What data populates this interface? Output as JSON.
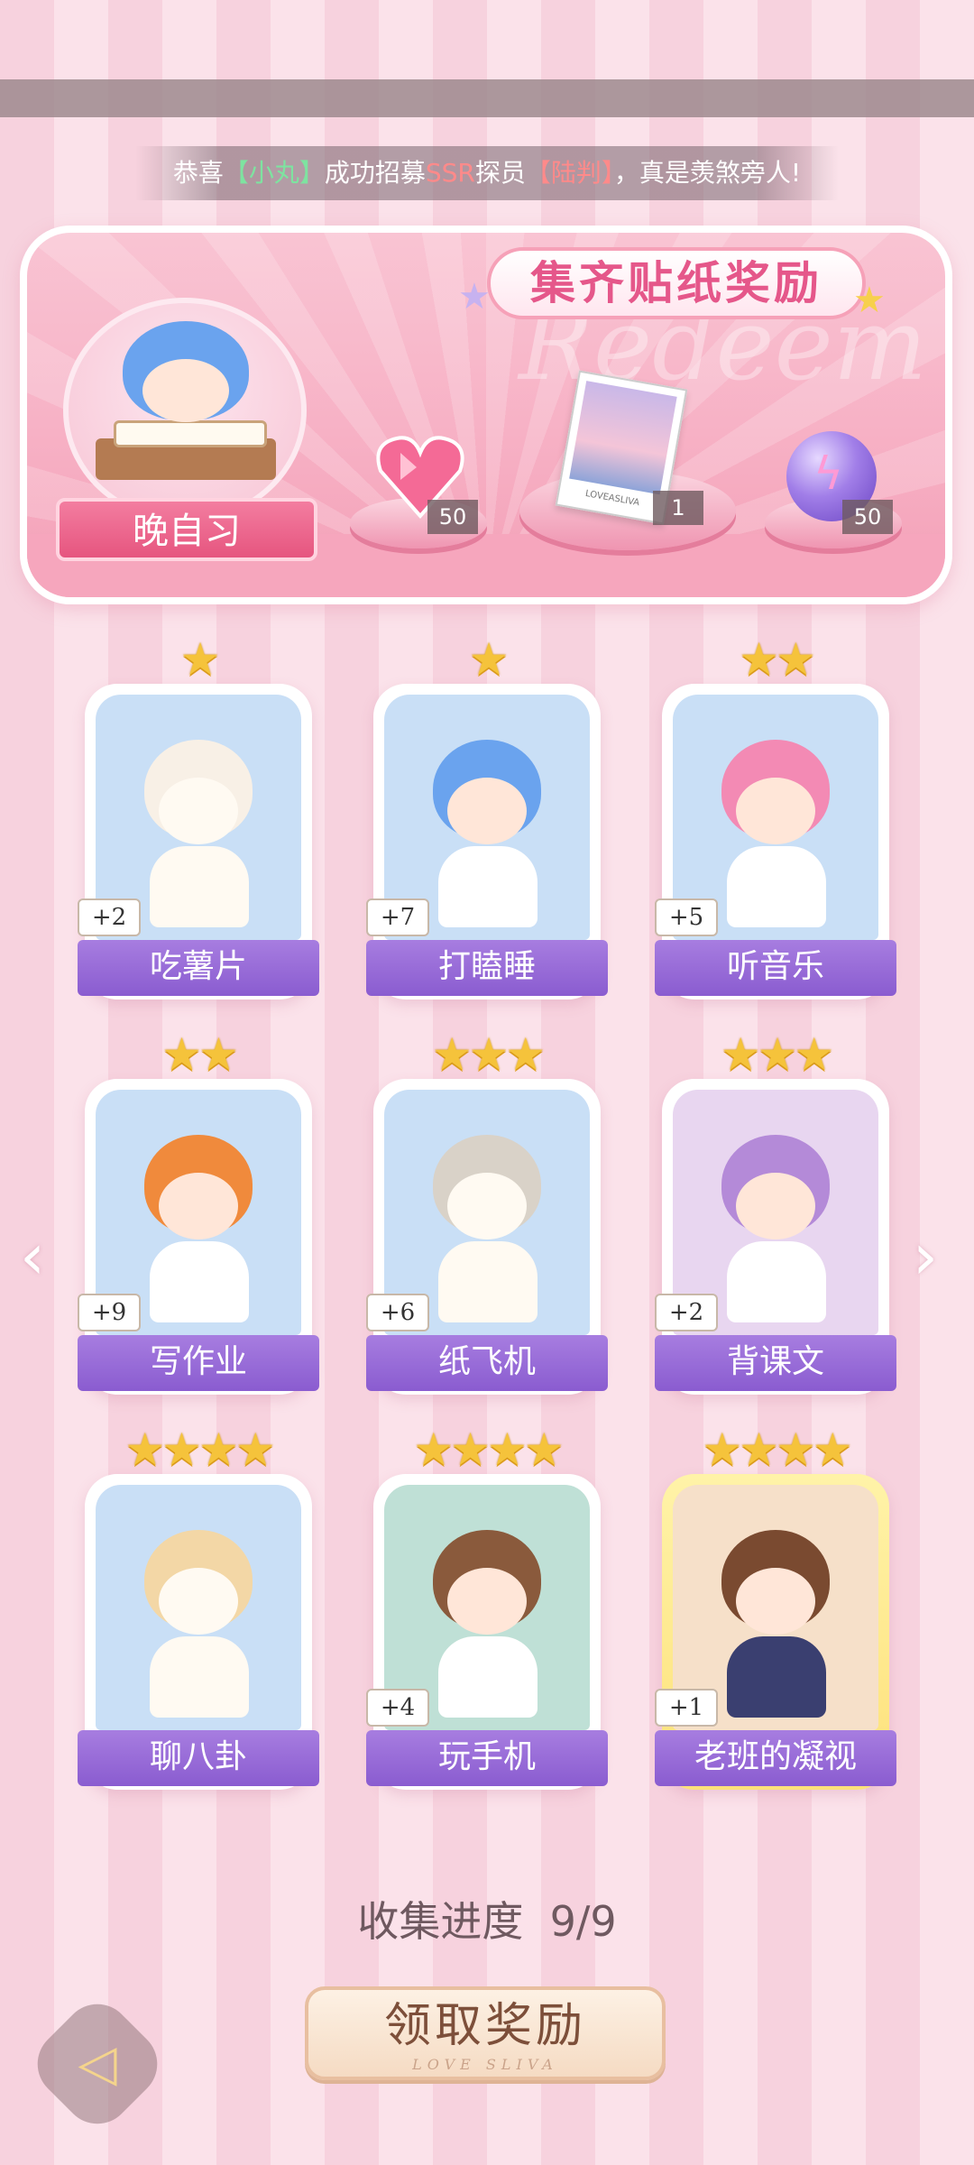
{
  "ticker": {
    "prefix": "恭喜",
    "recruiter": "【小丸】",
    "mid": "成功招募",
    "rarity": "SSR",
    "mid2": "探员",
    "recruit": "【陆判】",
    "suffix": "，真是羡煞旁人!"
  },
  "banner": {
    "title": "集齐贴纸奖励",
    "watermark": "Redeem",
    "portrait_label": "晚自习",
    "rewards": [
      {
        "icon": "heart-gem-icon",
        "count": "50"
      },
      {
        "icon": "photo-card-icon",
        "count": "1",
        "card_text": "LOVEASLIVA"
      },
      {
        "icon": "energy-orb-icon",
        "count": "50"
      }
    ]
  },
  "cards": [
    {
      "label": "吃薯片",
      "badge": "+2",
      "stars": "★"
    },
    {
      "label": "打瞌睡",
      "badge": "+7",
      "stars": "★"
    },
    {
      "label": "听音乐",
      "badge": "+5",
      "stars": "★★"
    },
    {
      "label": "写作业",
      "badge": "+9",
      "stars": "★★"
    },
    {
      "label": "纸飞机",
      "badge": "+6",
      "stars": "★★★"
    },
    {
      "label": "背课文",
      "badge": "+2",
      "stars": "★★★"
    },
    {
      "label": "聊八卦",
      "badge": "",
      "stars": "★★★★"
    },
    {
      "label": "玩手机",
      "badge": "+4",
      "stars": "★★★★"
    },
    {
      "label": "老班的凝视",
      "badge": "+1",
      "stars": "★★★★"
    }
  ],
  "progress": {
    "label": "收集进度",
    "value": "9/9"
  },
  "claim_button": {
    "label": "领取奖励",
    "sub": "LOVE SLIVA"
  },
  "colors": {
    "accent_pink": "#e5578a",
    "label_purple": "#8a5cd0",
    "star_gold": "#f5c33b"
  }
}
